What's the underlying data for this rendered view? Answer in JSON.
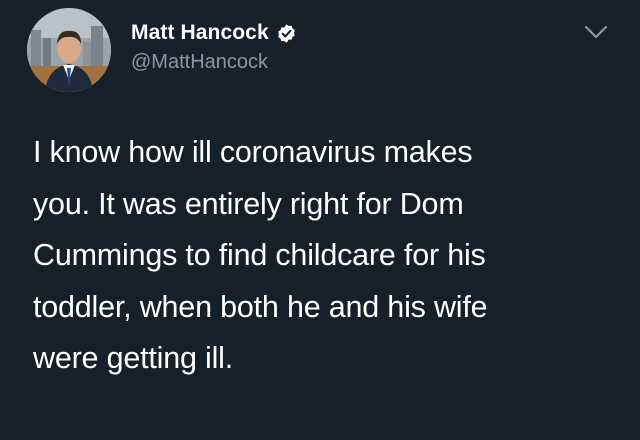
{
  "author": {
    "display_name": "Matt Hancock",
    "handle": "@MattHancock",
    "verified": true,
    "avatar_icon": "profile-photo",
    "verified_icon": "verified-badge-icon"
  },
  "menu": {
    "icon": "chevron-down-icon"
  },
  "tweet": {
    "lines": [
      "I know how ill coronavirus makes",
      "you. It was entirely right for Dom",
      "Cummings to find childcare for his",
      "toddler, when both he and his wife",
      "were getting ill."
    ]
  },
  "colors": {
    "background": "#15202b",
    "text_primary": "#ffffff",
    "text_secondary": "#8899a6"
  }
}
